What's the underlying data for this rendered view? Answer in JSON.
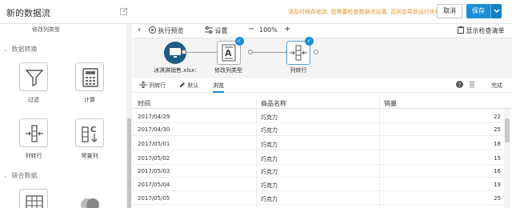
{
  "header": {
    "title": "新的数据流",
    "warning": "请及时保存修改, 您需要检查数据流设置, 否则会导致运行失败",
    "cancel_label": "取消",
    "save_label": "保存"
  },
  "left_panel": {
    "cut_label": "修改列类型",
    "sections": [
      {
        "label": "数据转换"
      },
      {
        "label": "联合数据"
      }
    ],
    "tools": [
      {
        "label": "过滤",
        "icon": "funnel-icon"
      },
      {
        "label": "计算",
        "icon": "calculator-icon"
      },
      {
        "label": "列转行",
        "icon": "column-to-row-icon"
      },
      {
        "label": "常量列",
        "icon": "constant-column-icon"
      }
    ]
  },
  "canvas_toolbar": {
    "run_preview": "执行预览",
    "settings": "设置",
    "zoom": "100%",
    "show_checklist": "显示检查清单"
  },
  "nodes": [
    {
      "label": "冰淇淋销售.xlsx:",
      "icon": "monitor-icon"
    },
    {
      "label": "修改列类型",
      "icon": "column-type-icon"
    },
    {
      "label": "列转行",
      "icon": "column-to-row-icon"
    }
  ],
  "node_tabs": {
    "column_to_row": "列转行",
    "default": "默认",
    "browse": "浏览",
    "done": "完成"
  },
  "table": {
    "columns": [
      "时间",
      "商品名称",
      "销量"
    ],
    "rows": [
      [
        "2017/04/29",
        "巧克力",
        "22"
      ],
      [
        "2017/04/30",
        "巧克力",
        "25"
      ],
      [
        "2017/05/01",
        "巧克力",
        "18"
      ],
      [
        "2017/05/02",
        "巧克力",
        "15"
      ],
      [
        "2017/05/03",
        "巧克力",
        "16"
      ],
      [
        "2017/05/04",
        "巧克力",
        "19"
      ],
      [
        "2017/05/05",
        "巧克力",
        "25"
      ]
    ]
  },
  "colors": {
    "accent": "#1a8fd8",
    "warning": "#e8962c"
  }
}
